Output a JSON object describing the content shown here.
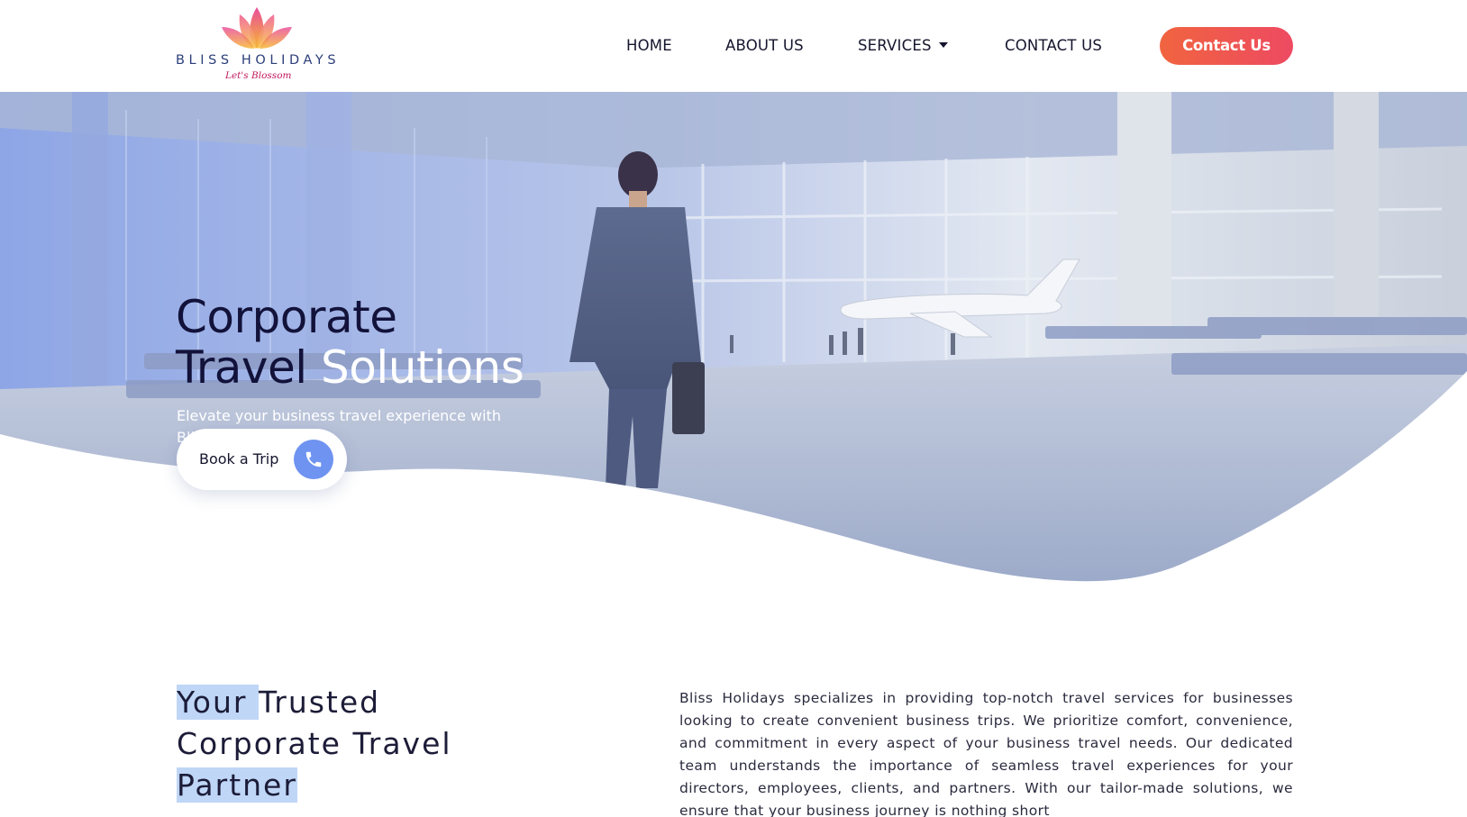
{
  "logo": {
    "name": "BLISS HOLIDAYS",
    "tagline": "Let's Blossom"
  },
  "nav": {
    "home": "HOME",
    "about": "ABOUT US",
    "services": "SERVICES",
    "contact": "CONTACT US",
    "cta": "Contact Us"
  },
  "hero": {
    "title_dark_1": "Corporate",
    "title_dark_2": "Travel",
    "title_light": "Solutions",
    "subtitle": "Elevate your business travel experience with Bliss Holidays.",
    "book_label": "Book a Trip"
  },
  "partner": {
    "title_highlight_1": "Your ",
    "title_1_rest": "Trusted",
    "title_2": "Corporate Travel",
    "title_highlight_3": "Partner",
    "body": "Bliss Holidays specializes in providing top-notch travel services for businesses looking to create convenient business trips. We prioritize comfort, convenience, and commitment in every aspect of your business travel needs. Our dedicated team understands the importance of seamless travel experiences for your directors,  employees, clients, and partners. With our tailor-made solutions, we ensure that your business journey is nothing short"
  },
  "colors": {
    "cta_gradient_start": "#f0643f",
    "cta_gradient_end": "#ee4a62",
    "phone_circle": "#6f93f0",
    "highlight": "#bfd6f6",
    "heading_dark": "#12123a"
  }
}
